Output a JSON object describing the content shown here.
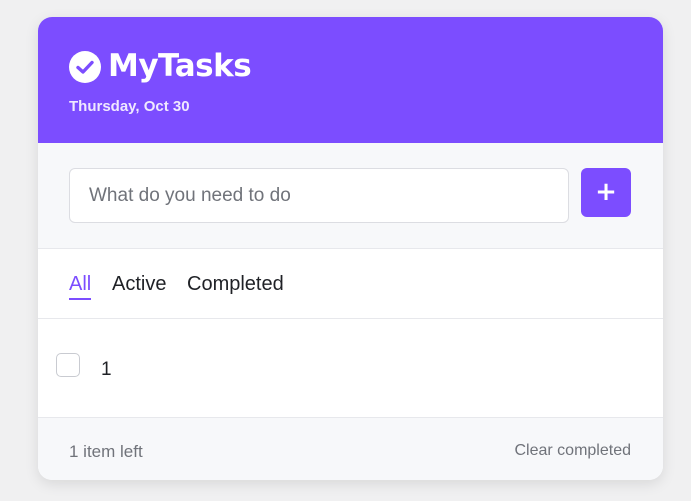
{
  "header": {
    "title": "MyTasks",
    "date": "Thursday, Oct 30",
    "icon": "check-circle-icon",
    "color": "#7c4dff"
  },
  "input": {
    "placeholder": "What do you need to do",
    "value": "",
    "add_label": "+"
  },
  "filters": {
    "tabs": [
      {
        "label": "All",
        "active": true
      },
      {
        "label": "Active",
        "active": false
      },
      {
        "label": "Completed",
        "active": false
      }
    ]
  },
  "tasks": [
    {
      "text": "1",
      "done": false
    }
  ],
  "footer": {
    "items_left": "1 item left",
    "clear_label": "Clear completed"
  }
}
